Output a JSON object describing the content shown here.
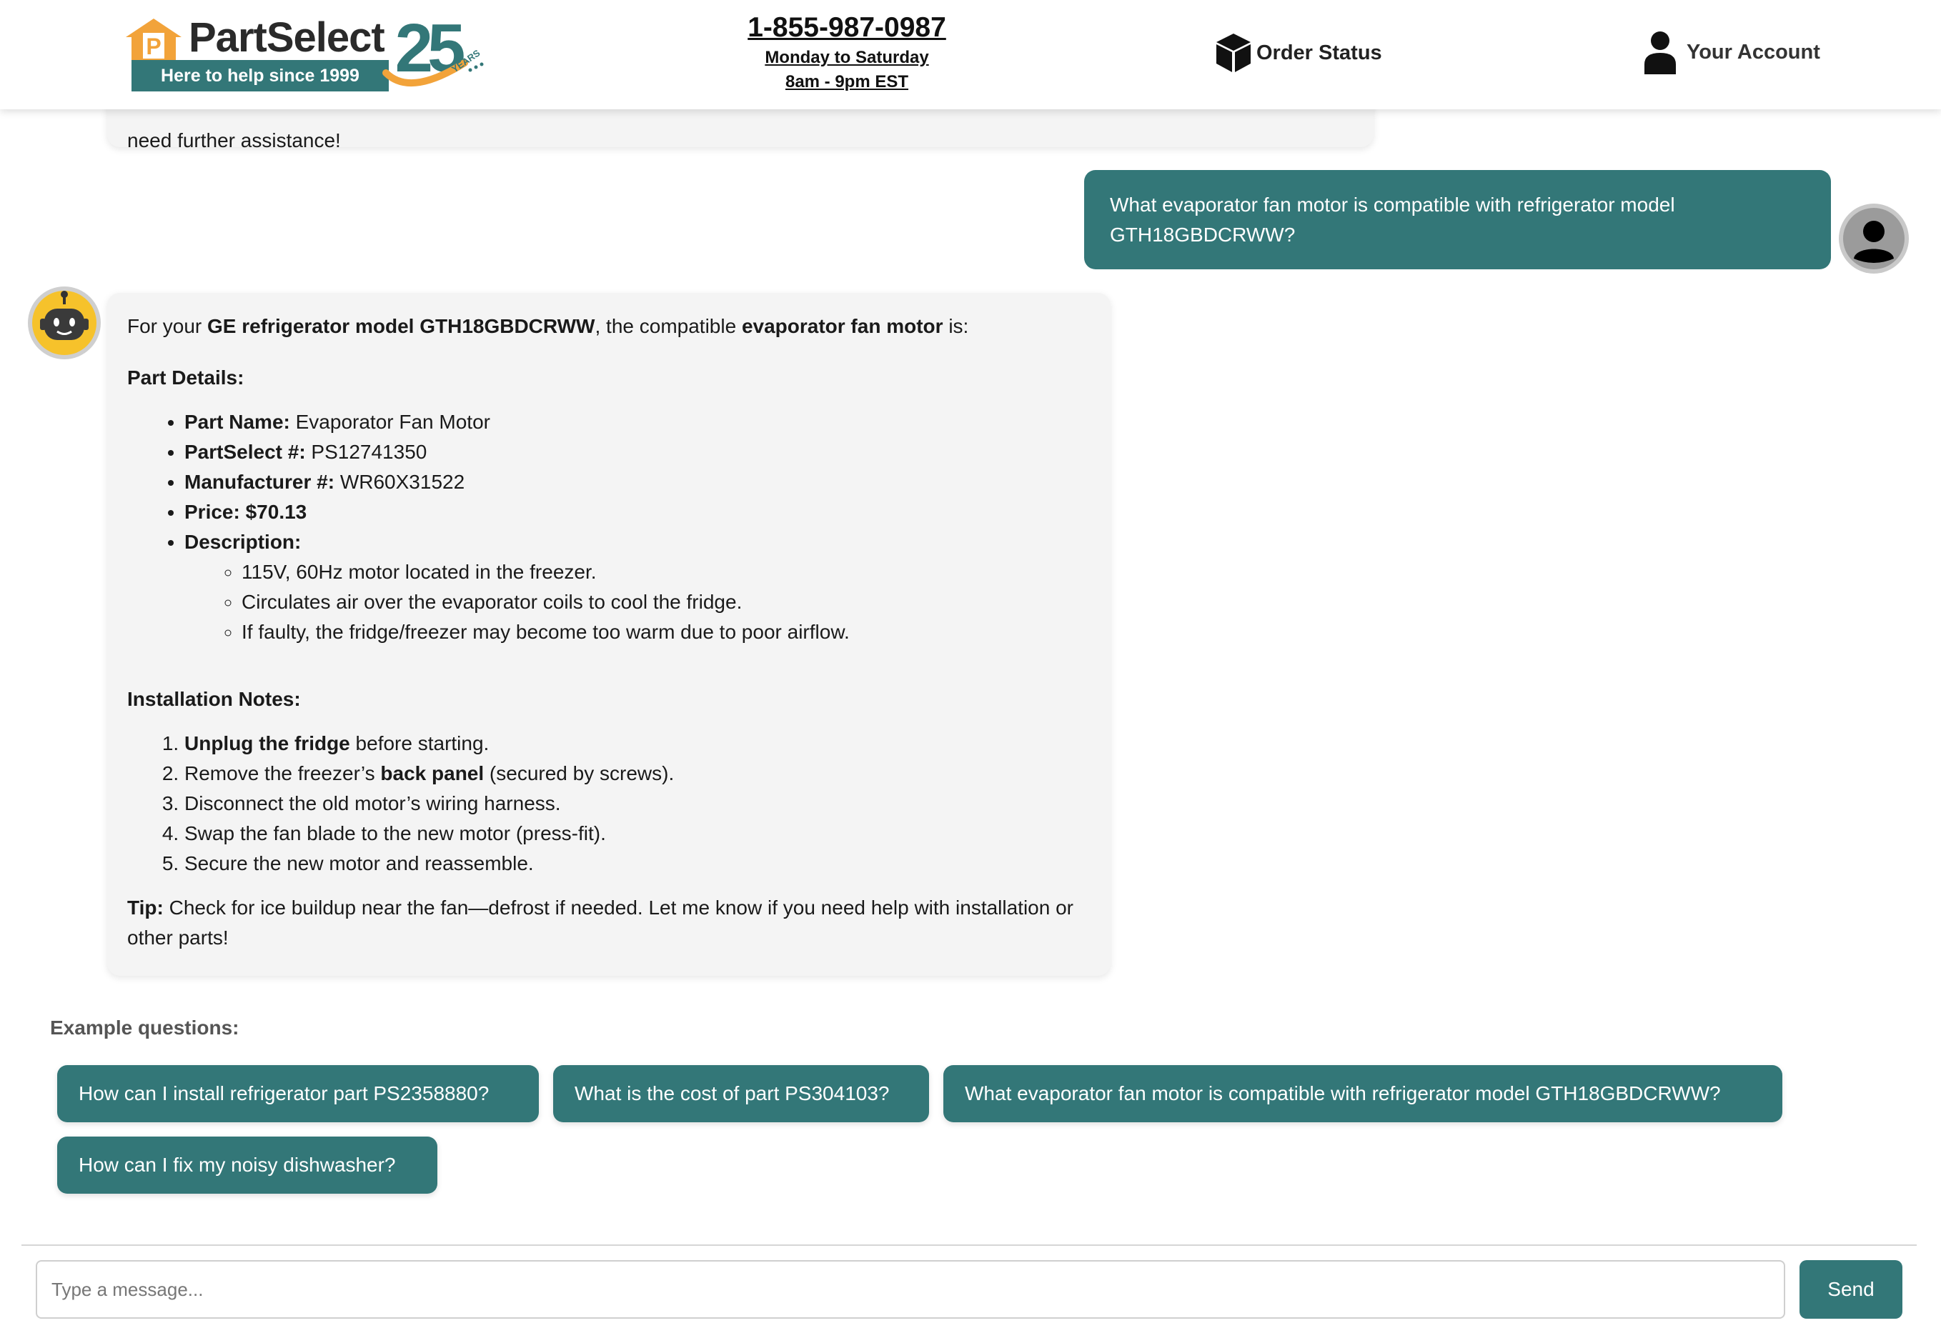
{
  "header": {
    "logo_name": "PartSelect",
    "logo_tagline": "Here to help since 1999",
    "anniversary_number": "25",
    "anniversary_word": "YEARS",
    "phone": "1-855-987-0987",
    "hours_days": "Monday to Saturday",
    "hours_time": "8am - 9pm EST",
    "order_status": "Order Status",
    "account": "Your Account",
    "icons": {
      "order": "box-icon",
      "account": "user-icon",
      "logo": "house-icon"
    }
  },
  "colors": {
    "brand_teal": "#337778",
    "brand_orange": "#F2A33A",
    "bubble_bg": "#F4F4F4"
  },
  "chat": {
    "previous_bot_tail": "need further assistance!",
    "user_message": "What evaporator fan motor is compatible with refrigerator model GTH18GBDCRWW?",
    "bot_reply": {
      "intro_1": "For your ",
      "intro_model": "GE refrigerator model GTH18GBDCRWW",
      "intro_2": ", the compatible ",
      "intro_part": "evaporator fan motor",
      "intro_3": " is:",
      "part_details_title": "Part Details:",
      "details": [
        {
          "label": "Part Name:",
          "value": " Evaporator Fan Motor"
        },
        {
          "label": "PartSelect #:",
          "value": " PS12741350"
        },
        {
          "label": "Manufacturer #:",
          "value": " WR60X31522"
        },
        {
          "label": "Price: $70.13",
          "value": ""
        },
        {
          "label": "Description:",
          "value": ""
        }
      ],
      "description": [
        "115V, 60Hz motor located in the freezer.",
        "Circulates air over the evaporator coils to cool the fridge.",
        "If faulty, the fridge/freezer may become too warm due to poor airflow."
      ],
      "installation_title": "Installation Notes:",
      "steps": [
        {
          "bold": "Unplug the fridge",
          "pre": "",
          "post": " before starting."
        },
        {
          "pre": "Remove the freezer’s ",
          "bold": "back panel",
          "post": " (secured by screws)."
        },
        {
          "pre": "Disconnect the old motor’s wiring harness.",
          "bold": "",
          "post": ""
        },
        {
          "pre": "Swap the fan blade to the new motor (press-fit).",
          "bold": "",
          "post": ""
        },
        {
          "pre": "Secure the new motor and reassemble.",
          "bold": "",
          "post": ""
        }
      ],
      "tip_label": "Tip:",
      "tip_text": " Check for ice buildup near the fan—defrost if needed. Let me know if you need help with installation or other parts!"
    }
  },
  "examples": {
    "label": "Example questions:",
    "questions": [
      "How can I install refrigerator part PS2358880?",
      "What is the cost of part PS304103?",
      "What evaporator fan motor is compatible with refrigerator model GTH18GBDCRWW?",
      "How can I fix my noisy dishwasher?"
    ]
  },
  "composer": {
    "placeholder": "Type a message...",
    "send_label": "Send"
  }
}
